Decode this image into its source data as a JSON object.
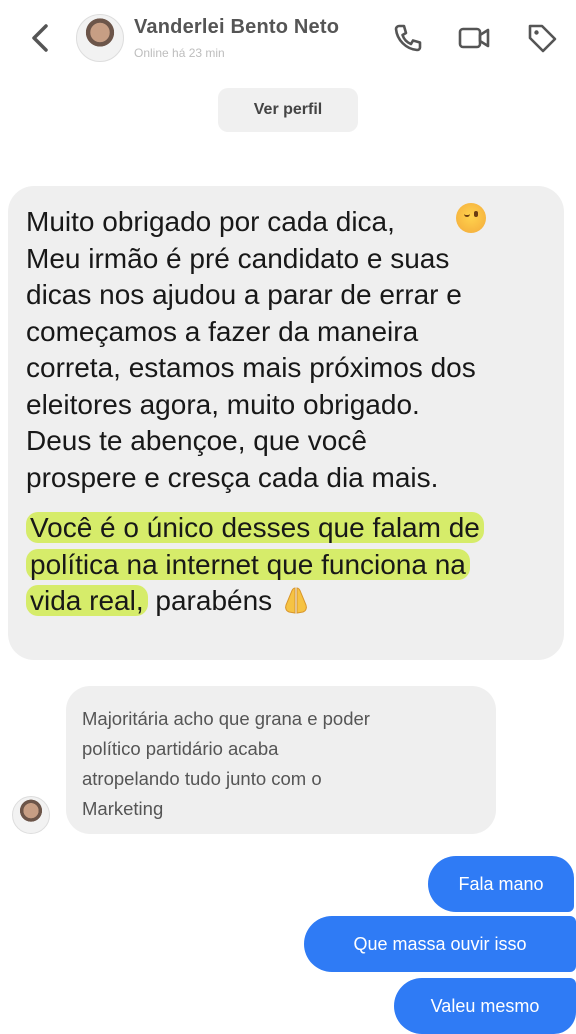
{
  "header": {
    "contact_name": "Vanderlei Bento Neto",
    "status": "Online há 23 min",
    "icons": [
      "back-icon",
      "phone-icon",
      "video-icon",
      "tag-icon"
    ]
  },
  "profile_button": "Ver perfil",
  "messages": {
    "main_text": "Muito obrigado por cada dica, \nMeu irmão é pré candidato e suas\ndicas nos ajudou a parar de errar e\ncomeçamos a fazer da maneira\ncorreta, estamos mais próximos dos\neleitores agora, muito obrigado.\nDeus te abençoe, que você\nprospere e cresça cada dia mais.",
    "highlight_line1": "Você é o único desses que falam de",
    "highlight_line2": "política na internet que funciona na",
    "highlight_line3": "vida real,",
    "tail": " parabéns ",
    "received_text": "Majoritária acho que grana e poder\npolítico partidário acaba\natropelando tudo junto com o\nMarketing",
    "sent": [
      "Fala mano",
      "Que massa ouvir isso",
      "Valeu mesmo"
    ]
  },
  "colors": {
    "highlight": "#d6ec6a",
    "sent_bubble": "#2f7bf5",
    "received_bubble": "#efefef"
  }
}
